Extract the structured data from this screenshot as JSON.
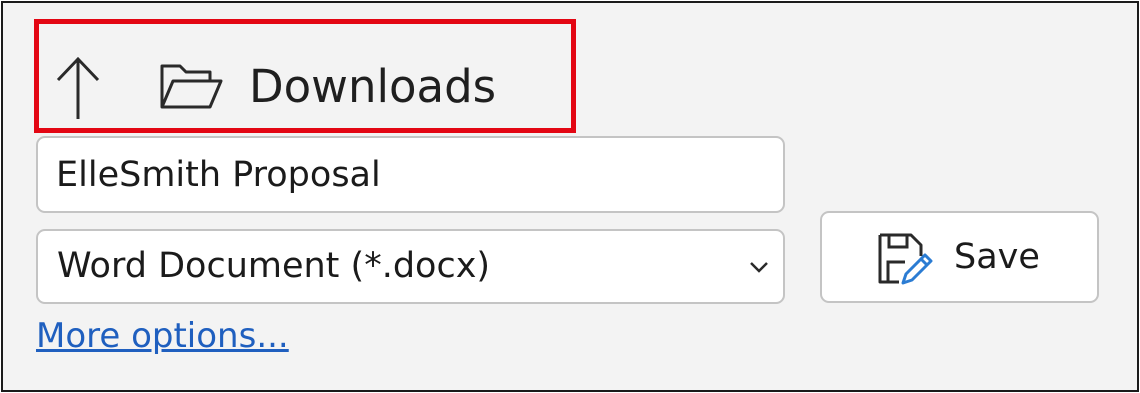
{
  "location": {
    "label": "Downloads",
    "up_icon": "arrow-up-icon",
    "folder_icon": "open-folder-icon"
  },
  "filename": {
    "value": "ElleSmith Proposal"
  },
  "filetype": {
    "selected": "Word Document (*.docx)",
    "dropdown_icon": "chevron-down-icon"
  },
  "save_button": {
    "label": "Save",
    "icon": "save-edit-icon"
  },
  "more_options": {
    "label": "More options..."
  },
  "colors": {
    "highlight": "#e30613",
    "link": "#1f5fbf",
    "icon_accent": "#2b7cd3",
    "background": "#f3f3f3"
  }
}
